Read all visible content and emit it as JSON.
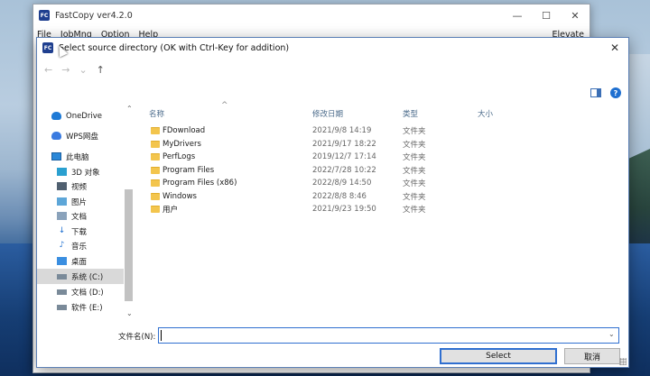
{
  "main_window": {
    "title": "FastCopy ver4.2.0",
    "menus": [
      "File",
      "JobMng",
      "Option",
      "Help"
    ],
    "elevate": "Elevate",
    "app_icon_text": "FC"
  },
  "dialog": {
    "title": "Select source directory (OK with Ctrl-Key for addition)",
    "close_glyph": "✕",
    "nav": {
      "back": "←",
      "forward": "→",
      "recent": "⌄",
      "up": "↑"
    },
    "columns": {
      "name": "名称",
      "modified": "修改日期",
      "type": "类型",
      "size": "大小"
    },
    "sidebar": [
      {
        "label": "OneDrive",
        "icon": "onedrive-icon"
      },
      {
        "label": "WPS网盘",
        "icon": "cloud-icon"
      },
      {
        "label": "此电脑",
        "icon": "computer-icon"
      },
      {
        "label": "3D 对象",
        "icon": "3d-objects-icon"
      },
      {
        "label": "视频",
        "icon": "video-icon"
      },
      {
        "label": "图片",
        "icon": "pictures-icon"
      },
      {
        "label": "文档",
        "icon": "documents-icon"
      },
      {
        "label": "下载",
        "icon": "downloads-icon"
      },
      {
        "label": "音乐",
        "icon": "music-icon"
      },
      {
        "label": "桌面",
        "icon": "desktop-icon"
      },
      {
        "label": "系统 (C:)",
        "icon": "drive-icon",
        "selected": true
      },
      {
        "label": "文档 (D:)",
        "icon": "drive-icon"
      },
      {
        "label": "软件 (E:)",
        "icon": "drive-icon"
      }
    ],
    "files": [
      {
        "name": "FDownload",
        "modified": "2021/9/8 14:19",
        "type": "文件夹"
      },
      {
        "name": "MyDrivers",
        "modified": "2021/9/17 18:22",
        "type": "文件夹"
      },
      {
        "name": "PerfLogs",
        "modified": "2019/12/7 17:14",
        "type": "文件夹"
      },
      {
        "name": "Program Files",
        "modified": "2022/7/28 10:22",
        "type": "文件夹"
      },
      {
        "name": "Program Files (x86)",
        "modified": "2022/8/9 14:50",
        "type": "文件夹"
      },
      {
        "name": "Windows",
        "modified": "2022/8/8 8:46",
        "type": "文件夹"
      },
      {
        "name": "用户",
        "modified": "2021/9/23 19:50",
        "type": "文件夹"
      }
    ],
    "filename_label": "文件名(N):",
    "filename_value": "",
    "select_button": "Select",
    "cancel_button": "取消"
  },
  "colors": {
    "accent": "#2f6fd0",
    "folder": "#f3c54d"
  }
}
